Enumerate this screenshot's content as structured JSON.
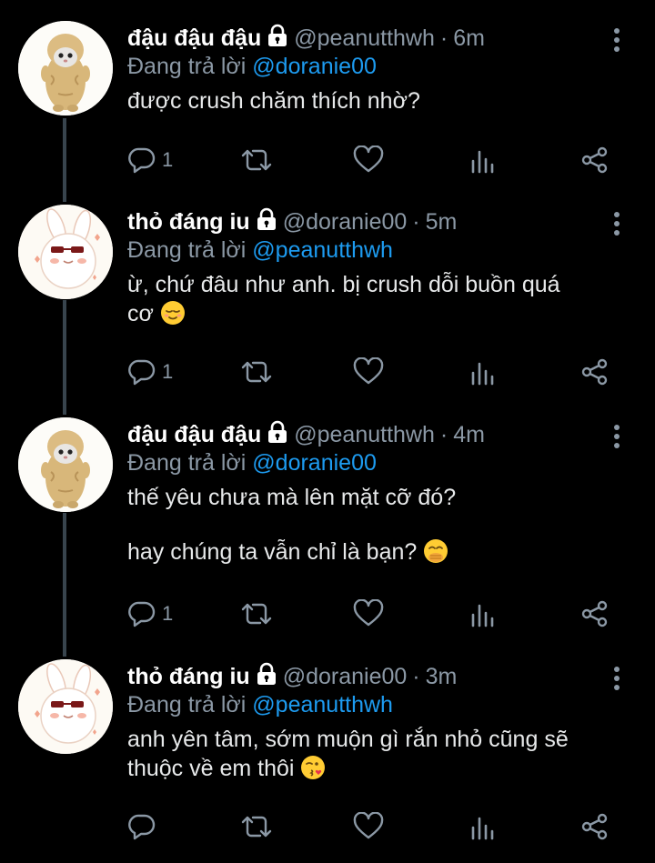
{
  "reply_prefix": "Đang trả lời",
  "tweets": [
    {
      "author": "đậu đậu đậu",
      "handle": "@peanutthwh",
      "dot": "·",
      "time": "6m",
      "reply_to": "@doranie00",
      "lines": [
        "được crush chăm thích nhờ?"
      ],
      "reply_count": "1",
      "avatar": "peanut-cat"
    },
    {
      "author": "thỏ đáng iu",
      "handle": "@doranie00",
      "dot": "·",
      "time": "5m",
      "reply_to": "@peanutthwh",
      "lines": [
        "ừ, chứ đâu như anh. bị crush dỗi buồn quá",
        "cơ"
      ],
      "emoji": "relieved-face",
      "reply_count": "1",
      "avatar": "bunny"
    },
    {
      "author": "đậu đậu đậu",
      "handle": "@peanutthwh",
      "dot": "·",
      "time": "4m",
      "reply_to": "@doranie00",
      "lines": [
        "thế yêu chưa mà lên mặt cỡ đó?",
        "hay chúng ta vẫn chỉ là bạn?"
      ],
      "emoji": "hand-over-mouth-face",
      "reply_count": "1",
      "avatar": "peanut-cat"
    },
    {
      "author": "thỏ đáng iu",
      "handle": "@doranie00",
      "dot": "·",
      "time": "3m",
      "reply_to": "@peanutthwh",
      "lines": [
        "anh yên tâm, sớm muộn gì rắn nhỏ cũng sẽ",
        "thuộc về em thôi"
      ],
      "emoji": "kissing-face",
      "reply_count": "",
      "avatar": "bunny"
    }
  ],
  "colors": {
    "background": "#000000",
    "text": "#e7e9ea",
    "muted": "#8b98a5",
    "accent": "#1d9bf0",
    "thread_line": "#38444d"
  }
}
